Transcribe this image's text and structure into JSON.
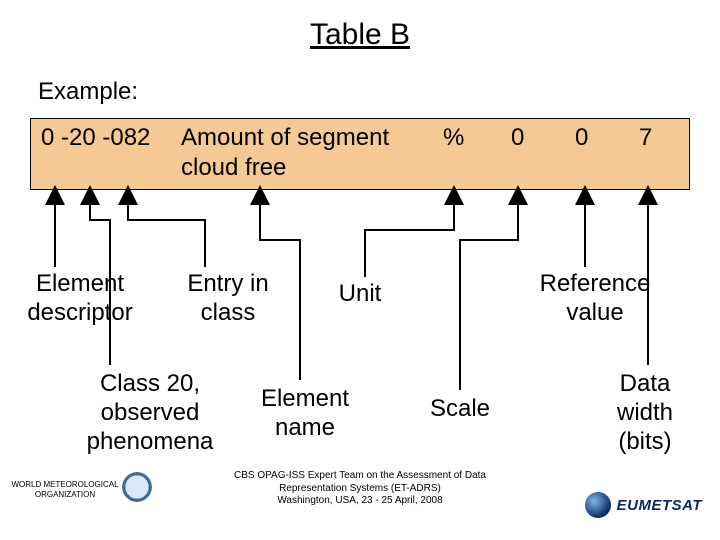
{
  "title": "Table B",
  "example_label": "Example:",
  "row": {
    "code": "0 -20 -082",
    "name": "Amount of segment cloud free",
    "unit": "%",
    "scale": "0",
    "reference": "0",
    "data_width": "7"
  },
  "labels": {
    "element_descriptor": "Element descriptor",
    "entry_in_class": "Entry in class",
    "unit": "Unit",
    "reference_value": "Reference value",
    "class20": "Class 20, observed phenomena",
    "element_name": "Element name",
    "scale": "Scale",
    "data_width": "Data width (bits)"
  },
  "footer": {
    "line1": "CBS OPAG-ISS Expert Team on the Assessment of Data",
    "line2": "Representation Systems (ET-ADRS)",
    "line3": "Washington, USA, 23 - 25 April, 2008"
  },
  "wmo": "WORLD METEOROLOGICAL ORGANIZATION",
  "eumetsat": "EUMETSAT"
}
